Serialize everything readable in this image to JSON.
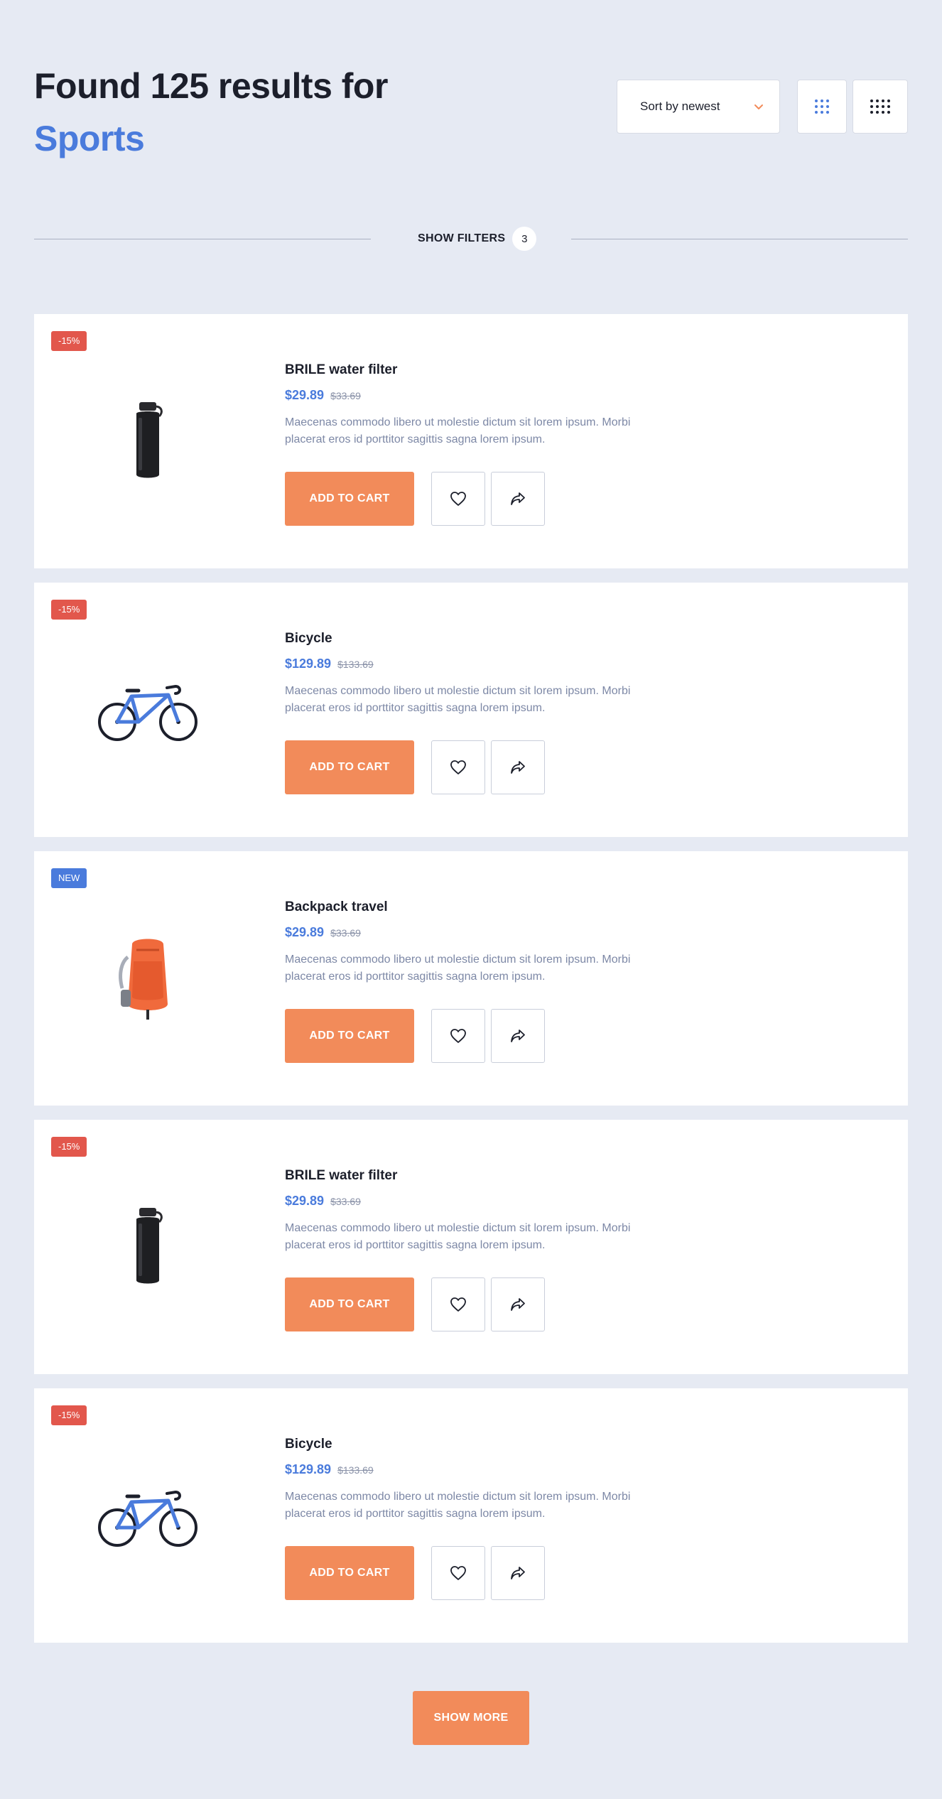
{
  "header": {
    "title_line1": "Found 125 results for",
    "title_line2": "Sports"
  },
  "controls": {
    "sort_label": "Sort by newest",
    "sort_icon": "chevron-down-icon",
    "view_grid_small_icon": "grid-3x3-icon",
    "view_grid_large_icon": "grid-4x3-icon"
  },
  "filters": {
    "label": "SHOW FILTERS",
    "count": "3"
  },
  "products": [
    {
      "badge": "-15%",
      "badge_type": "sale",
      "image": "water-bottle",
      "name": "BRILE water filter",
      "price": "$29.89",
      "old_price": "$33.69",
      "description": "Maecenas commodo libero ut molestie dictum sit lorem ipsum. Morbi placerat eros id porttitor sagittis sagna lorem ipsum.",
      "cart_label": "ADD TO CART"
    },
    {
      "badge": "-15%",
      "badge_type": "sale",
      "image": "bicycle",
      "name": "Bicycle",
      "price": "$129.89",
      "old_price": "$133.69",
      "description": "Maecenas commodo libero ut molestie dictum sit lorem ipsum. Morbi placerat eros id porttitor sagittis sagna lorem ipsum.",
      "cart_label": "ADD TO CART"
    },
    {
      "badge": "NEW",
      "badge_type": "new",
      "image": "backpack",
      "name": "Backpack travel",
      "price": "$29.89",
      "old_price": "$33.69",
      "description": "Maecenas commodo libero ut molestie dictum sit lorem ipsum. Morbi placerat eros id porttitor sagittis sagna lorem ipsum.",
      "cart_label": "ADD TO CART"
    },
    {
      "badge": "-15%",
      "badge_type": "sale",
      "image": "water-bottle",
      "name": "BRILE water filter",
      "price": "$29.89",
      "old_price": "$33.69",
      "description": "Maecenas commodo libero ut molestie dictum sit lorem ipsum. Morbi placerat eros id porttitor sagittis sagna lorem ipsum.",
      "cart_label": "ADD TO CART"
    },
    {
      "badge": "-15%",
      "badge_type": "sale",
      "image": "bicycle",
      "name": "Bicycle",
      "price": "$129.89",
      "old_price": "$133.69",
      "description": "Maecenas commodo libero ut molestie dictum sit lorem ipsum. Morbi placerat eros id porttitor sagittis sagna lorem ipsum.",
      "cart_label": "ADD TO CART"
    }
  ],
  "show_more_label": "SHOW MORE",
  "colors": {
    "background": "#e6eaf3",
    "accent": "#4a7bdc",
    "cta": "#f28b5a",
    "sale_badge": "#e2574c",
    "new_badge": "#4a7bdc"
  }
}
